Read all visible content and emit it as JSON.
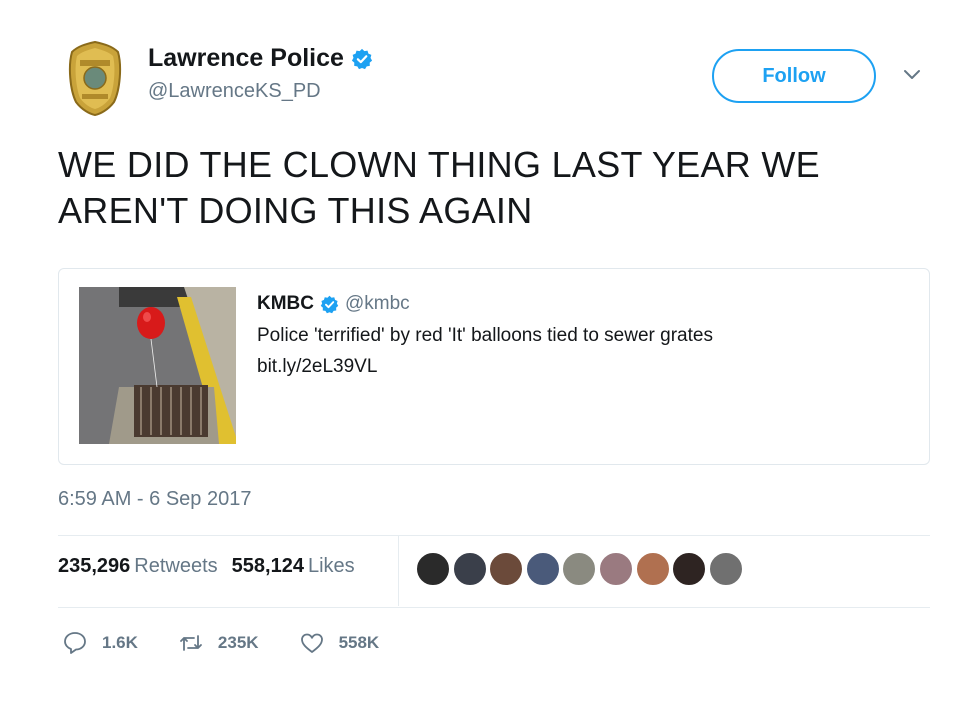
{
  "author": {
    "name": "Lawrence Police",
    "handle": "@LawrenceKS_PD",
    "avatar_icon": "police-badge-icon",
    "verified_icon": "verified-badge-icon"
  },
  "follow_label": "Follow",
  "tweet_text": "WE DID THE CLOWN THING LAST YEAR WE AREN'T DOING THIS AGAIN",
  "quote": {
    "name": "KMBC",
    "handle": "@kmbc",
    "text": "Police 'terrified' by red 'It' balloons tied to sewer grates",
    "link": "bit.ly/2eL39VL"
  },
  "timestamp": "6:59 AM - 6 Sep 2017",
  "stats": {
    "retweets_count": "235,296",
    "retweets_label": "Retweets",
    "likes_count": "558,124",
    "likes_label": "Likes"
  },
  "likers": [
    {
      "color": "#2a2a2a"
    },
    {
      "color": "#3a3f4a"
    },
    {
      "color": "#6b4a3a"
    },
    {
      "color": "#4a5a7a"
    },
    {
      "color": "#8a8a80"
    },
    {
      "color": "#9a7a80"
    },
    {
      "color": "#b07050"
    },
    {
      "color": "#2e2422"
    },
    {
      "color": "#707070"
    }
  ],
  "actions": {
    "reply_count": "1.6K",
    "retweet_count": "235K",
    "like_count": "558K"
  },
  "colors": {
    "accent": "#1da1f2",
    "text": "#14171a",
    "secondary": "#657786"
  }
}
